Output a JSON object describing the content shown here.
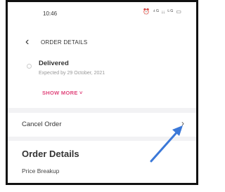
{
  "status_bar": {
    "time": "10:46",
    "icons": "⏰ ⁴ᴳ ᵢᵢ ⁵ᴳ ▭"
  },
  "header": {
    "back_icon": "back-chevron",
    "title": "ORDER DETAILS"
  },
  "tracking": {
    "status": "Delivered",
    "expected": "Expected by 29 October, 2021",
    "show_more": "SHOW MORE"
  },
  "cancel": {
    "label": "Cancel Order"
  },
  "order_details": {
    "title": "Order Details",
    "price_breakup": "Price Breakup"
  },
  "colors": {
    "accent": "#e0457b",
    "arrow": "#3b78d8"
  }
}
